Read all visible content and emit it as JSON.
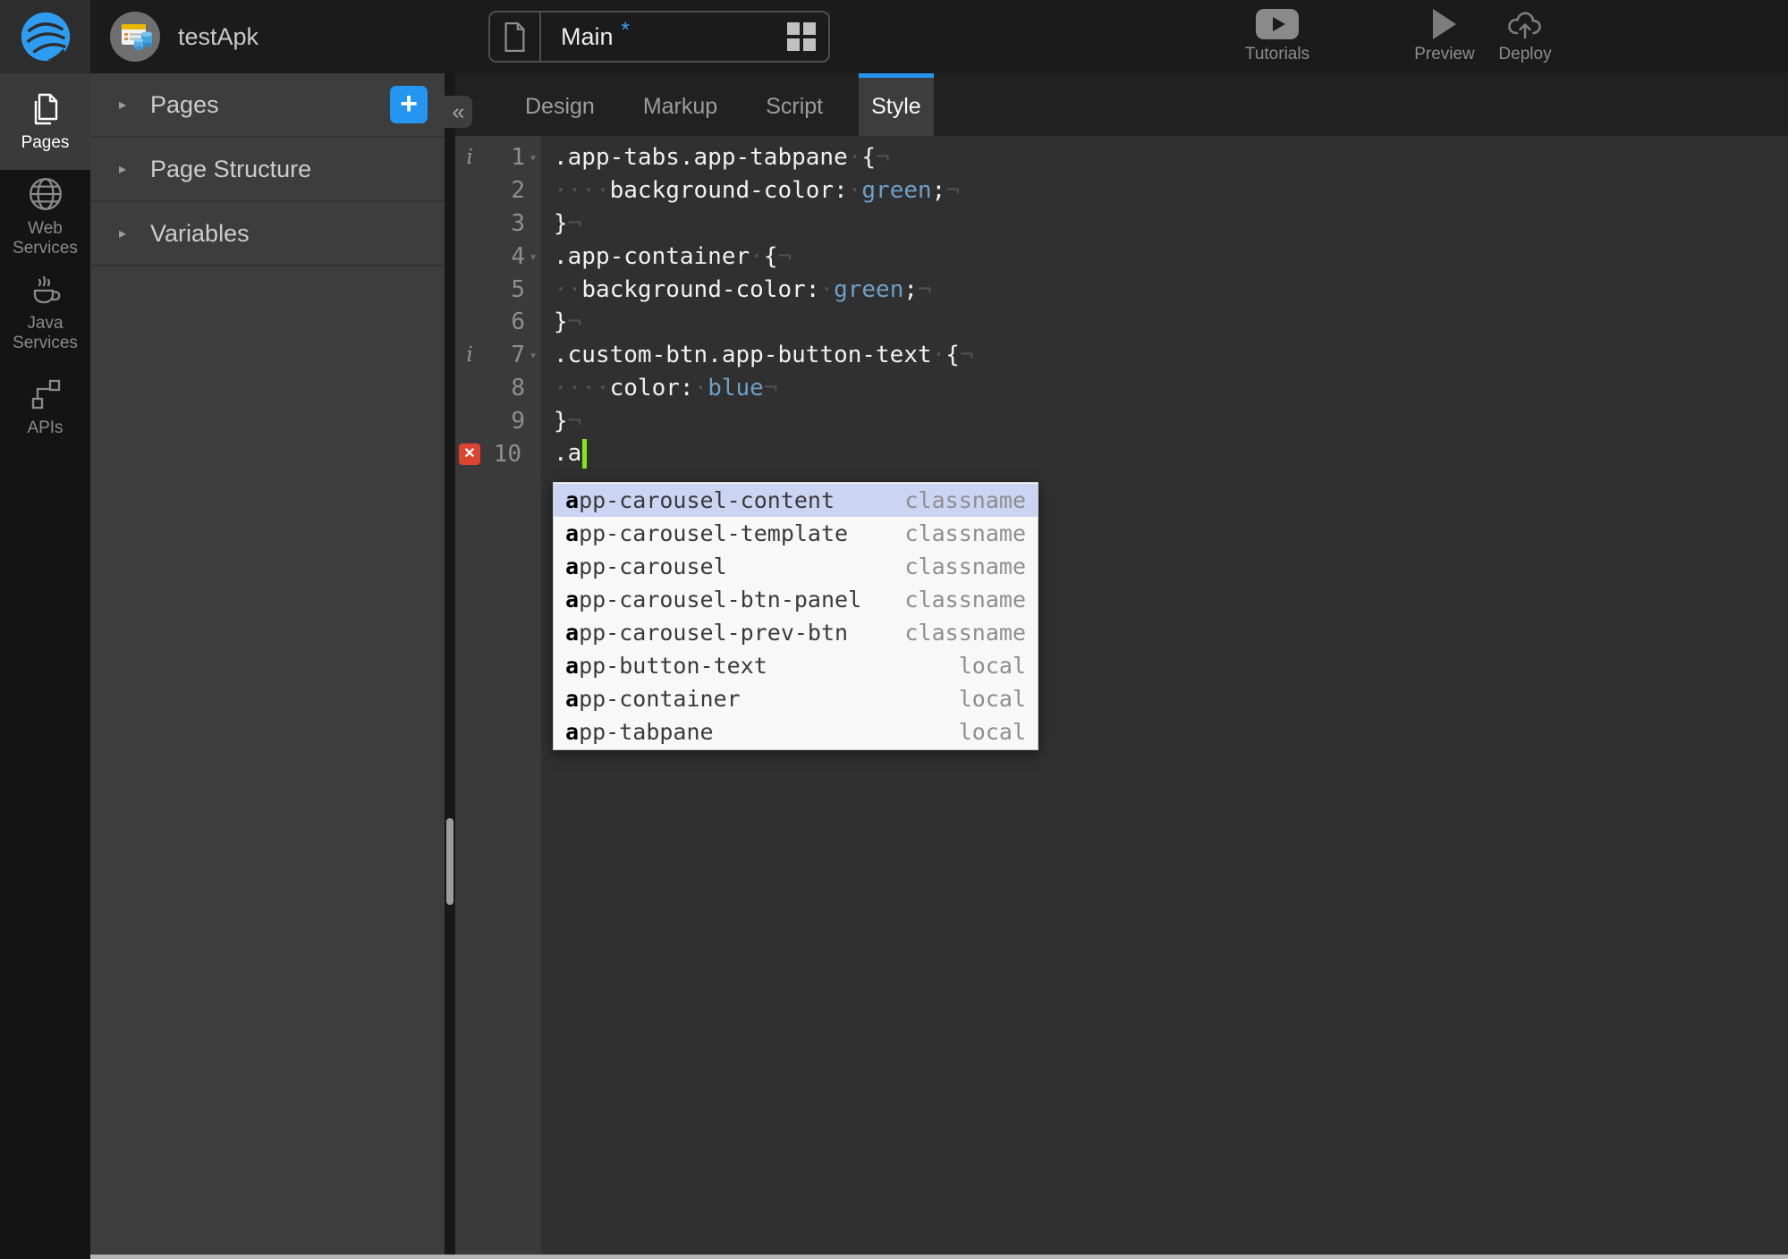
{
  "colors": {
    "accent_blue": "#2595f2",
    "cursor_green": "#84e61e",
    "error_red": "#dd4430",
    "css_value_blue": "#6f9fc8",
    "completion_selected_bg": "#ccd4f3",
    "active_tab_bg": "#3d3d3d"
  },
  "glyphs": {
    "section_caret": "▸",
    "fold_caret": "▾",
    "collapse_chevrons": "«",
    "add_plus": "+",
    "error_x": "✕",
    "info_i": "i",
    "space_dot": "·",
    "eol_mark": "¬"
  },
  "topbar": {
    "app_name": "testApk",
    "page_selector": {
      "page_name": "Main",
      "dirty_marker": "*"
    },
    "actions": [
      {
        "label": "Tutorials",
        "icon": "video-tutorials-icon"
      },
      {
        "label": "Preview",
        "icon": "play-icon"
      },
      {
        "label": "Deploy",
        "icon": "cloud-upload-icon"
      }
    ]
  },
  "sidebar": {
    "items": [
      {
        "label": "Pages",
        "icon": "pages-icon",
        "active": true
      },
      {
        "label": "Web Services",
        "icon": "globe-icon",
        "active": false
      },
      {
        "label": "Java Services",
        "icon": "coffee-cup-icon",
        "active": false
      },
      {
        "label": "APIs",
        "icon": "api-flow-icon",
        "active": false
      }
    ]
  },
  "panel": {
    "sections": [
      {
        "label": "Pages"
      },
      {
        "label": "Page Structure"
      },
      {
        "label": "Variables"
      }
    ]
  },
  "editor": {
    "tabs": [
      {
        "label": "Design",
        "active": false
      },
      {
        "label": "Markup",
        "active": false
      },
      {
        "label": "Script",
        "active": false
      },
      {
        "label": "Style",
        "active": true
      }
    ],
    "lines": [
      {
        "num": "1",
        "ann": "info",
        "fold": true,
        "segs": [
          [
            "p",
            ".app-tabs.app-tabpane"
          ],
          [
            "i",
            "·"
          ],
          [
            "p",
            "{"
          ],
          [
            "i",
            "¬"
          ]
        ]
      },
      {
        "num": "2",
        "ann": null,
        "fold": false,
        "segs": [
          [
            "i",
            "····"
          ],
          [
            "p",
            "background-color:"
          ],
          [
            "i",
            "·"
          ],
          [
            "v",
            "green"
          ],
          [
            "p",
            ";"
          ],
          [
            "i",
            "¬"
          ]
        ]
      },
      {
        "num": "3",
        "ann": null,
        "fold": false,
        "segs": [
          [
            "p",
            "}"
          ],
          [
            "i",
            "¬"
          ]
        ]
      },
      {
        "num": "4",
        "ann": null,
        "fold": true,
        "segs": [
          [
            "p",
            ".app-container"
          ],
          [
            "i",
            "·"
          ],
          [
            "p",
            "{"
          ],
          [
            "i",
            "¬"
          ]
        ]
      },
      {
        "num": "5",
        "ann": null,
        "fold": false,
        "segs": [
          [
            "i",
            "··"
          ],
          [
            "p",
            "background-color:"
          ],
          [
            "i",
            "·"
          ],
          [
            "v",
            "green"
          ],
          [
            "p",
            ";"
          ],
          [
            "i",
            "¬"
          ]
        ]
      },
      {
        "num": "6",
        "ann": null,
        "fold": false,
        "segs": [
          [
            "p",
            "}"
          ],
          [
            "i",
            "¬"
          ]
        ]
      },
      {
        "num": "7",
        "ann": "info",
        "fold": true,
        "segs": [
          [
            "p",
            ".custom-btn.app-button-text"
          ],
          [
            "i",
            "·"
          ],
          [
            "p",
            "{"
          ],
          [
            "i",
            "¬"
          ]
        ]
      },
      {
        "num": "8",
        "ann": null,
        "fold": false,
        "segs": [
          [
            "i",
            "····"
          ],
          [
            "p",
            "color:"
          ],
          [
            "i",
            "·"
          ],
          [
            "v",
            "blue"
          ],
          [
            "i",
            "¬"
          ]
        ]
      },
      {
        "num": "9",
        "ann": null,
        "fold": false,
        "segs": [
          [
            "p",
            "}"
          ],
          [
            "i",
            "¬"
          ]
        ]
      },
      {
        "num": "10",
        "ann": "error",
        "fold": false,
        "cursor": true,
        "segs": [
          [
            "p",
            ".a"
          ]
        ]
      }
    ],
    "autocomplete": {
      "typed_prefix": "a",
      "items": [
        {
          "label": "app-carousel-content",
          "meta": "classname",
          "selected": true
        },
        {
          "label": "app-carousel-template",
          "meta": "classname",
          "selected": false
        },
        {
          "label": "app-carousel",
          "meta": "classname",
          "selected": false
        },
        {
          "label": "app-carousel-btn-panel",
          "meta": "classname",
          "selected": false
        },
        {
          "label": "app-carousel-prev-btn",
          "meta": "classname",
          "selected": false
        },
        {
          "label": "app-button-text",
          "meta": "local",
          "selected": false
        },
        {
          "label": "app-container",
          "meta": "local",
          "selected": false
        },
        {
          "label": "app-tabpane",
          "meta": "local",
          "selected": false
        }
      ]
    }
  }
}
